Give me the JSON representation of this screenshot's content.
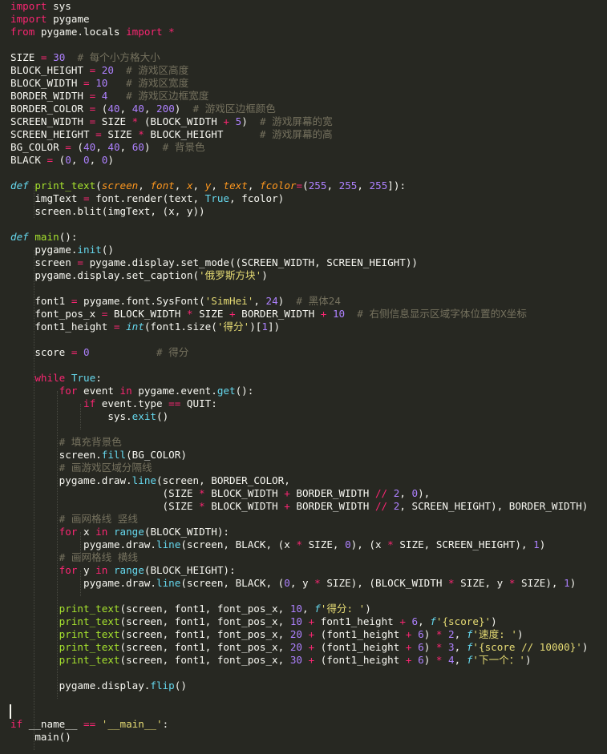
{
  "editor": {
    "theme_colors": {
      "background": "#272822",
      "keyword": "#f92672",
      "function": "#a6e22e",
      "builtin": "#66d9ef",
      "number": "#ae81ff",
      "string": "#e6db74",
      "comment": "#75715e",
      "parameter": "#fd971f",
      "plain": "#f8f8f2"
    },
    "lines": [
      [
        [
          "kw",
          "import"
        ],
        [
          "pl",
          " sys"
        ]
      ],
      [
        [
          "kw",
          "import"
        ],
        [
          "pl",
          " pygame"
        ]
      ],
      [
        [
          "kw",
          "from"
        ],
        [
          "pl",
          " pygame.locals "
        ],
        [
          "kw",
          "import"
        ],
        [
          "pl",
          " "
        ],
        [
          "op",
          "*"
        ]
      ],
      [],
      [
        [
          "pl",
          "SIZE "
        ],
        [
          "op",
          "="
        ],
        [
          "pl",
          " "
        ],
        [
          "num",
          "30"
        ],
        [
          "pl",
          "  "
        ],
        [
          "cm",
          "# 每个小方格大小"
        ]
      ],
      [
        [
          "pl",
          "BLOCK_HEIGHT "
        ],
        [
          "op",
          "="
        ],
        [
          "pl",
          " "
        ],
        [
          "num",
          "20"
        ],
        [
          "pl",
          "  "
        ],
        [
          "cm",
          "# 游戏区高度"
        ]
      ],
      [
        [
          "pl",
          "BLOCK_WIDTH "
        ],
        [
          "op",
          "="
        ],
        [
          "pl",
          " "
        ],
        [
          "num",
          "10"
        ],
        [
          "pl",
          "   "
        ],
        [
          "cm",
          "# 游戏区宽度"
        ]
      ],
      [
        [
          "pl",
          "BORDER_WIDTH "
        ],
        [
          "op",
          "="
        ],
        [
          "pl",
          " "
        ],
        [
          "num",
          "4"
        ],
        [
          "pl",
          "   "
        ],
        [
          "cm",
          "# 游戏区边框宽度"
        ]
      ],
      [
        [
          "pl",
          "BORDER_COLOR "
        ],
        [
          "op",
          "="
        ],
        [
          "pl",
          " ("
        ],
        [
          "num",
          "40"
        ],
        [
          "pl",
          ", "
        ],
        [
          "num",
          "40"
        ],
        [
          "pl",
          ", "
        ],
        [
          "num",
          "200"
        ],
        [
          "pl",
          ")  "
        ],
        [
          "cm",
          "# 游戏区边框颜色"
        ]
      ],
      [
        [
          "pl",
          "SCREEN_WIDTH "
        ],
        [
          "op",
          "="
        ],
        [
          "pl",
          " SIZE "
        ],
        [
          "op",
          "*"
        ],
        [
          "pl",
          " (BLOCK_WIDTH "
        ],
        [
          "op",
          "+"
        ],
        [
          "pl",
          " "
        ],
        [
          "num",
          "5"
        ],
        [
          "pl",
          ")  "
        ],
        [
          "cm",
          "# 游戏屏幕的宽"
        ]
      ],
      [
        [
          "pl",
          "SCREEN_HEIGHT "
        ],
        [
          "op",
          "="
        ],
        [
          "pl",
          " SIZE "
        ],
        [
          "op",
          "*"
        ],
        [
          "pl",
          " BLOCK_HEIGHT      "
        ],
        [
          "cm",
          "# 游戏屏幕的高"
        ]
      ],
      [
        [
          "pl",
          "BG_COLOR "
        ],
        [
          "op",
          "="
        ],
        [
          "pl",
          " ("
        ],
        [
          "num",
          "40"
        ],
        [
          "pl",
          ", "
        ],
        [
          "num",
          "40"
        ],
        [
          "pl",
          ", "
        ],
        [
          "num",
          "60"
        ],
        [
          "pl",
          ")  "
        ],
        [
          "cm",
          "# 背景色"
        ]
      ],
      [
        [
          "pl",
          "BLACK "
        ],
        [
          "op",
          "="
        ],
        [
          "pl",
          " ("
        ],
        [
          "num",
          "0"
        ],
        [
          "pl",
          ", "
        ],
        [
          "num",
          "0"
        ],
        [
          "pl",
          ", "
        ],
        [
          "num",
          "0"
        ],
        [
          "pl",
          ")"
        ]
      ],
      [],
      [
        [
          "bi-i",
          "def"
        ],
        [
          "pl",
          " "
        ],
        [
          "fn",
          "print_text"
        ],
        [
          "pl",
          "("
        ],
        [
          "par",
          "screen"
        ],
        [
          "pl",
          ", "
        ],
        [
          "par",
          "font"
        ],
        [
          "pl",
          ", "
        ],
        [
          "par",
          "x"
        ],
        [
          "pl",
          ", "
        ],
        [
          "par",
          "y"
        ],
        [
          "pl",
          ", "
        ],
        [
          "par",
          "text"
        ],
        [
          "pl",
          ", "
        ],
        [
          "par",
          "fcolor"
        ],
        [
          "op",
          "="
        ],
        [
          "pl",
          "("
        ],
        [
          "num",
          "255"
        ],
        [
          "pl",
          ", "
        ],
        [
          "num",
          "255"
        ],
        [
          "pl",
          ", "
        ],
        [
          "num",
          "255"
        ],
        [
          "pl",
          "]):"
        ]
      ],
      [
        [
          "pl",
          "    imgText "
        ],
        [
          "op",
          "="
        ],
        [
          "pl",
          " font.render(text, "
        ],
        [
          "bi",
          "True"
        ],
        [
          "pl",
          ", fcolor)"
        ]
      ],
      [
        [
          "pl",
          "    screen.blit(imgText, (x, y))"
        ]
      ],
      [],
      [
        [
          "bi-i",
          "def"
        ],
        [
          "pl",
          " "
        ],
        [
          "fn",
          "main"
        ],
        [
          "pl",
          "():"
        ]
      ],
      [
        [
          "pl",
          "    pygame."
        ],
        [
          "bi",
          "init"
        ],
        [
          "pl",
          "()"
        ]
      ],
      [
        [
          "pl",
          "    screen "
        ],
        [
          "op",
          "="
        ],
        [
          "pl",
          " pygame.display.set_mode((SCREEN_WIDTH, SCREEN_HEIGHT))"
        ]
      ],
      [
        [
          "pl",
          "    pygame.display.set_caption("
        ],
        [
          "str",
          "'俄罗斯方块'"
        ],
        [
          "pl",
          ")"
        ]
      ],
      [],
      [
        [
          "pl",
          "    font1 "
        ],
        [
          "op",
          "="
        ],
        [
          "pl",
          " pygame.font.SysFont("
        ],
        [
          "str",
          "'SimHei'"
        ],
        [
          "pl",
          ", "
        ],
        [
          "num",
          "24"
        ],
        [
          "pl",
          ")  "
        ],
        [
          "cm",
          "# 黑体24"
        ]
      ],
      [
        [
          "pl",
          "    font_pos_x "
        ],
        [
          "op",
          "="
        ],
        [
          "pl",
          " BLOCK_WIDTH "
        ],
        [
          "op",
          "*"
        ],
        [
          "pl",
          " SIZE "
        ],
        [
          "op",
          "+"
        ],
        [
          "pl",
          " BORDER_WIDTH "
        ],
        [
          "op",
          "+"
        ],
        [
          "pl",
          " "
        ],
        [
          "num",
          "10"
        ],
        [
          "pl",
          "  "
        ],
        [
          "cm",
          "# 右侧信息显示区域字体位置的X坐标"
        ]
      ],
      [
        [
          "pl",
          "    font1_height "
        ],
        [
          "op",
          "="
        ],
        [
          "pl",
          " "
        ],
        [
          "bi-i",
          "int"
        ],
        [
          "pl",
          "(font1.size("
        ],
        [
          "str",
          "'得分'"
        ],
        [
          "pl",
          ")["
        ],
        [
          "num",
          "1"
        ],
        [
          "pl",
          "])"
        ]
      ],
      [],
      [
        [
          "pl",
          "    score "
        ],
        [
          "op",
          "="
        ],
        [
          "pl",
          " "
        ],
        [
          "num",
          "0"
        ],
        [
          "pl",
          "           "
        ],
        [
          "cm",
          "# 得分"
        ]
      ],
      [],
      [
        [
          "pl",
          "    "
        ],
        [
          "kw",
          "while"
        ],
        [
          "pl",
          " "
        ],
        [
          "bi",
          "True"
        ],
        [
          "pl",
          ":"
        ]
      ],
      [
        [
          "pl",
          "        "
        ],
        [
          "kw",
          "for"
        ],
        [
          "pl",
          " event "
        ],
        [
          "kw",
          "in"
        ],
        [
          "pl",
          " pygame.event."
        ],
        [
          "bi",
          "get"
        ],
        [
          "pl",
          "():"
        ]
      ],
      [
        [
          "pl",
          "            "
        ],
        [
          "kw",
          "if"
        ],
        [
          "pl",
          " event.type "
        ],
        [
          "op",
          "=="
        ],
        [
          "pl",
          " QUIT:"
        ]
      ],
      [
        [
          "pl",
          "                sys."
        ],
        [
          "bi",
          "exit"
        ],
        [
          "pl",
          "()"
        ]
      ],
      [],
      [
        [
          "pl",
          "        "
        ],
        [
          "cm",
          "# 填充背景色"
        ]
      ],
      [
        [
          "pl",
          "        screen."
        ],
        [
          "bi",
          "fill"
        ],
        [
          "pl",
          "(BG_COLOR)"
        ]
      ],
      [
        [
          "pl",
          "        "
        ],
        [
          "cm",
          "# 画游戏区域分隔线"
        ]
      ],
      [
        [
          "pl",
          "        pygame.draw."
        ],
        [
          "bi",
          "line"
        ],
        [
          "pl",
          "(screen, BORDER_COLOR,"
        ]
      ],
      [
        [
          "pl",
          "                         (SIZE "
        ],
        [
          "op",
          "*"
        ],
        [
          "pl",
          " BLOCK_WIDTH "
        ],
        [
          "op",
          "+"
        ],
        [
          "pl",
          " BORDER_WIDTH "
        ],
        [
          "op",
          "//"
        ],
        [
          "pl",
          " "
        ],
        [
          "num",
          "2"
        ],
        [
          "pl",
          ", "
        ],
        [
          "num",
          "0"
        ],
        [
          "pl",
          "),"
        ]
      ],
      [
        [
          "pl",
          "                         (SIZE "
        ],
        [
          "op",
          "*"
        ],
        [
          "pl",
          " BLOCK_WIDTH "
        ],
        [
          "op",
          "+"
        ],
        [
          "pl",
          " BORDER_WIDTH "
        ],
        [
          "op",
          "//"
        ],
        [
          "pl",
          " "
        ],
        [
          "num",
          "2"
        ],
        [
          "pl",
          ", SCREEN_HEIGHT), BORDER_WIDTH)"
        ]
      ],
      [
        [
          "pl",
          "        "
        ],
        [
          "cm",
          "# 画网格线 竖线"
        ]
      ],
      [
        [
          "pl",
          "        "
        ],
        [
          "kw",
          "for"
        ],
        [
          "pl",
          " x "
        ],
        [
          "kw",
          "in"
        ],
        [
          "pl",
          " "
        ],
        [
          "bi",
          "range"
        ],
        [
          "pl",
          "(BLOCK_WIDTH):"
        ]
      ],
      [
        [
          "pl",
          "            pygame.draw."
        ],
        [
          "bi",
          "line"
        ],
        [
          "pl",
          "(screen, BLACK, (x "
        ],
        [
          "op",
          "*"
        ],
        [
          "pl",
          " SIZE, "
        ],
        [
          "num",
          "0"
        ],
        [
          "pl",
          "), (x "
        ],
        [
          "op",
          "*"
        ],
        [
          "pl",
          " SIZE, SCREEN_HEIGHT), "
        ],
        [
          "num",
          "1"
        ],
        [
          "pl",
          ")"
        ]
      ],
      [
        [
          "pl",
          "        "
        ],
        [
          "cm",
          "# 画网格线 横线"
        ]
      ],
      [
        [
          "pl",
          "        "
        ],
        [
          "kw",
          "for"
        ],
        [
          "pl",
          " y "
        ],
        [
          "kw",
          "in"
        ],
        [
          "pl",
          " "
        ],
        [
          "bi",
          "range"
        ],
        [
          "pl",
          "(BLOCK_HEIGHT):"
        ]
      ],
      [
        [
          "pl",
          "            pygame.draw."
        ],
        [
          "bi",
          "line"
        ],
        [
          "pl",
          "(screen, BLACK, ("
        ],
        [
          "num",
          "0"
        ],
        [
          "pl",
          ", y "
        ],
        [
          "op",
          "*"
        ],
        [
          "pl",
          " SIZE), (BLOCK_WIDTH "
        ],
        [
          "op",
          "*"
        ],
        [
          "pl",
          " SIZE, y "
        ],
        [
          "op",
          "*"
        ],
        [
          "pl",
          " SIZE), "
        ],
        [
          "num",
          "1"
        ],
        [
          "pl",
          ")"
        ]
      ],
      [],
      [
        [
          "pl",
          "        "
        ],
        [
          "fn",
          "print_text"
        ],
        [
          "pl",
          "(screen, font1, font_pos_x, "
        ],
        [
          "num",
          "10"
        ],
        [
          "pl",
          ", "
        ],
        [
          "bi-i",
          "f"
        ],
        [
          "str",
          "'得分: '"
        ],
        [
          "pl",
          ")"
        ]
      ],
      [
        [
          "pl",
          "        "
        ],
        [
          "fn",
          "print_text"
        ],
        [
          "pl",
          "(screen, font1, font_pos_x, "
        ],
        [
          "num",
          "10"
        ],
        [
          "pl",
          " "
        ],
        [
          "op",
          "+"
        ],
        [
          "pl",
          " font1_height "
        ],
        [
          "op",
          "+"
        ],
        [
          "pl",
          " "
        ],
        [
          "num",
          "6"
        ],
        [
          "pl",
          ", "
        ],
        [
          "bi-i",
          "f"
        ],
        [
          "str",
          "'{score}'"
        ],
        [
          "pl",
          ")"
        ]
      ],
      [
        [
          "pl",
          "        "
        ],
        [
          "fn",
          "print_text"
        ],
        [
          "pl",
          "(screen, font1, font_pos_x, "
        ],
        [
          "num",
          "20"
        ],
        [
          "pl",
          " "
        ],
        [
          "op",
          "+"
        ],
        [
          "pl",
          " (font1_height "
        ],
        [
          "op",
          "+"
        ],
        [
          "pl",
          " "
        ],
        [
          "num",
          "6"
        ],
        [
          "pl",
          ") "
        ],
        [
          "op",
          "*"
        ],
        [
          "pl",
          " "
        ],
        [
          "num",
          "2"
        ],
        [
          "pl",
          ", "
        ],
        [
          "bi-i",
          "f"
        ],
        [
          "str",
          "'速度: '"
        ],
        [
          "pl",
          ")"
        ]
      ],
      [
        [
          "pl",
          "        "
        ],
        [
          "fn",
          "print_text"
        ],
        [
          "pl",
          "(screen, font1, font_pos_x, "
        ],
        [
          "num",
          "20"
        ],
        [
          "pl",
          " "
        ],
        [
          "op",
          "+"
        ],
        [
          "pl",
          " (font1_height "
        ],
        [
          "op",
          "+"
        ],
        [
          "pl",
          " "
        ],
        [
          "num",
          "6"
        ],
        [
          "pl",
          ") "
        ],
        [
          "op",
          "*"
        ],
        [
          "pl",
          " "
        ],
        [
          "num",
          "3"
        ],
        [
          "pl",
          ", "
        ],
        [
          "bi-i",
          "f"
        ],
        [
          "str",
          "'{score // 10000}'"
        ],
        [
          "pl",
          ")"
        ]
      ],
      [
        [
          "pl",
          "        "
        ],
        [
          "fn",
          "print_text"
        ],
        [
          "pl",
          "(screen, font1, font_pos_x, "
        ],
        [
          "num",
          "30"
        ],
        [
          "pl",
          " "
        ],
        [
          "op",
          "+"
        ],
        [
          "pl",
          " (font1_height "
        ],
        [
          "op",
          "+"
        ],
        [
          "pl",
          " "
        ],
        [
          "num",
          "6"
        ],
        [
          "pl",
          ") "
        ],
        [
          "op",
          "*"
        ],
        [
          "pl",
          " "
        ],
        [
          "num",
          "4"
        ],
        [
          "pl",
          ", "
        ],
        [
          "bi-i",
          "f"
        ],
        [
          "str",
          "'下一个：'"
        ],
        [
          "pl",
          ")"
        ]
      ],
      [],
      [
        [
          "pl",
          "        pygame.display."
        ],
        [
          "bi",
          "flip"
        ],
        [
          "pl",
          "()"
        ]
      ],
      [],
      [],
      [
        [
          "kw",
          "if"
        ],
        [
          "pl",
          " __name__ "
        ],
        [
          "op",
          "=="
        ],
        [
          "pl",
          " "
        ],
        [
          "str",
          "'__main__'"
        ],
        [
          "pl",
          ":"
        ]
      ],
      [
        [
          "pl",
          "    main()"
        ]
      ]
    ]
  }
}
